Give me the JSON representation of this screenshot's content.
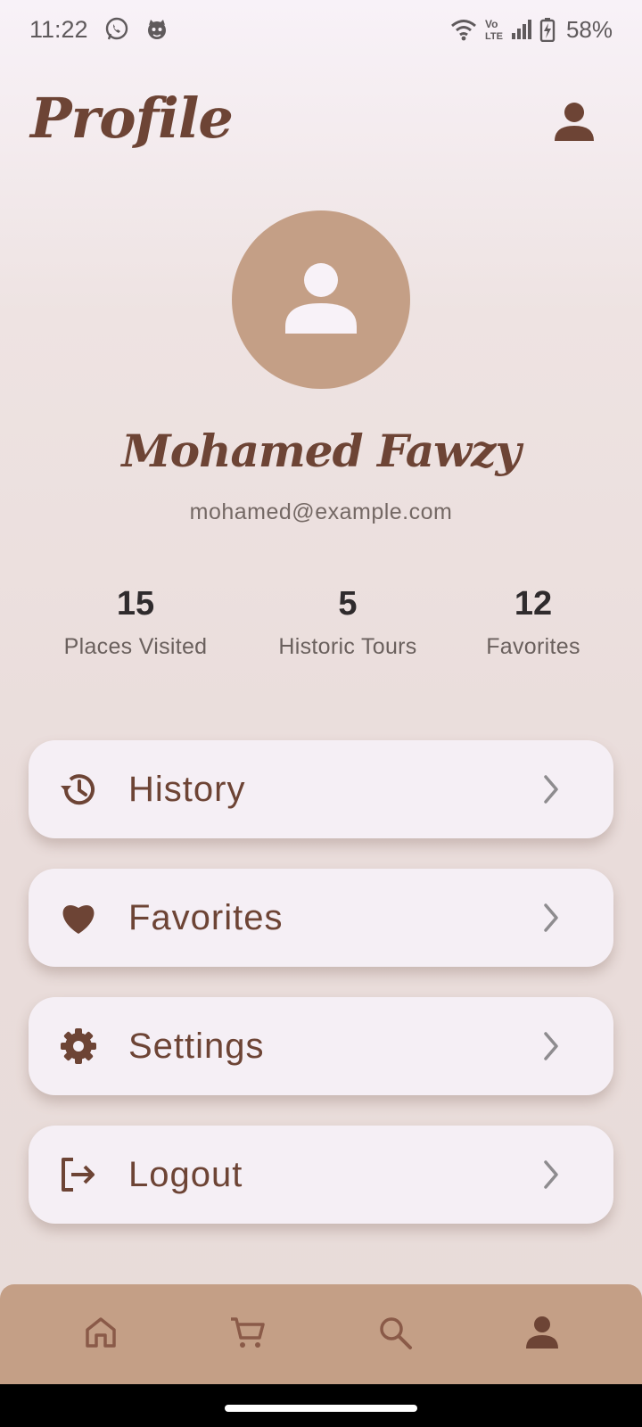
{
  "status_bar": {
    "time": "11:22",
    "battery": "58%",
    "icons": [
      "whatsapp-icon",
      "cat-icon",
      "wifi-icon",
      "volte-icon",
      "signal-icon",
      "battery-charging-icon"
    ]
  },
  "header": {
    "title": "Profile",
    "profile_icon": "person-icon"
  },
  "user": {
    "name": "Mohamed Fawzy",
    "email": "mohamed@example.com"
  },
  "stats": [
    {
      "value": "15",
      "label": "Places Visited"
    },
    {
      "value": "5",
      "label": "Historic Tours"
    },
    {
      "value": "12",
      "label": "Favorites"
    }
  ],
  "menu": [
    {
      "label": "History",
      "icon": "history-icon"
    },
    {
      "label": "Favorites",
      "icon": "heart-icon"
    },
    {
      "label": "Settings",
      "icon": "gear-icon"
    },
    {
      "label": "Logout",
      "icon": "logout-icon"
    }
  ],
  "bottom_nav": [
    {
      "icon": "home-icon",
      "active": false
    },
    {
      "icon": "cart-icon",
      "active": false
    },
    {
      "icon": "search-icon",
      "active": false
    },
    {
      "icon": "person-icon",
      "active": true
    }
  ],
  "colors": {
    "brand_brown": "#6d4435",
    "accent_tan": "#c49f86",
    "card_bg": "#f5eff5"
  }
}
